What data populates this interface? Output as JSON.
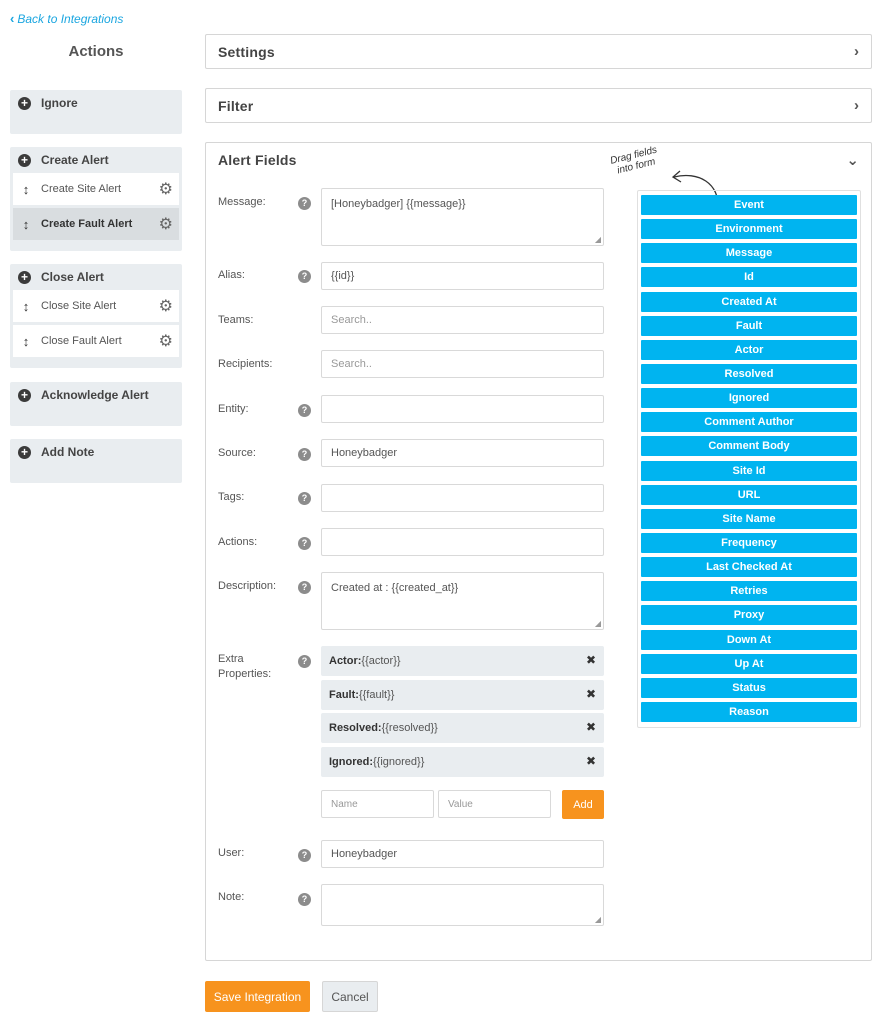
{
  "back_link": "Back to Integrations",
  "sidebar": {
    "title": "Actions",
    "groups": [
      {
        "label": "Ignore",
        "items": []
      },
      {
        "label": "Create Alert",
        "items": [
          {
            "label": "Create Site Alert"
          },
          {
            "label": "Create Fault Alert"
          }
        ]
      },
      {
        "label": "Close Alert",
        "items": [
          {
            "label": "Close Site Alert"
          },
          {
            "label": "Close Fault Alert"
          }
        ]
      },
      {
        "label": "Acknowledge Alert",
        "items": []
      },
      {
        "label": "Add Note",
        "items": []
      }
    ]
  },
  "panels": {
    "settings": "Settings",
    "filter": "Filter",
    "alert_fields": "Alert Fields"
  },
  "fields": {
    "message": {
      "label": "Message:",
      "value": "[Honeybadger] {{message}}"
    },
    "alias": {
      "label": "Alias:",
      "value": "{{id}}"
    },
    "teams": {
      "label": "Teams:",
      "placeholder": "Search.."
    },
    "recipients": {
      "label": "Recipients:",
      "placeholder": "Search.."
    },
    "entity": {
      "label": "Entity:",
      "value": ""
    },
    "source": {
      "label": "Source:",
      "value": "Honeybadger"
    },
    "tags": {
      "label": "Tags:",
      "value": ""
    },
    "actions": {
      "label": "Actions:",
      "value": ""
    },
    "description": {
      "label": "Description:",
      "value": "Created at : {{created_at}}"
    },
    "extra_properties": {
      "label_line1": "Extra",
      "label_line2": "Properties:",
      "items": [
        {
          "key": "Actor:",
          "value": "{{actor}}"
        },
        {
          "key": "Fault:",
          "value": "{{fault}}"
        },
        {
          "key": "Resolved:",
          "value": "{{resolved}}"
        },
        {
          "key": "Ignored:",
          "value": "{{ignored}}"
        }
      ],
      "name_placeholder": "Name",
      "value_placeholder": "Value",
      "add_label": "Add"
    },
    "user": {
      "label": "User:",
      "value": "Honeybadger"
    },
    "note": {
      "label": "Note:",
      "value": ""
    }
  },
  "drag_hint": {
    "line1": "Drag fields",
    "line2": "into form"
  },
  "dynamic_fields": [
    "Event",
    "Environment",
    "Message",
    "Id",
    "Created At",
    "Fault",
    "Actor",
    "Resolved",
    "Ignored",
    "Comment Author",
    "Comment Body",
    "Site Id",
    "URL",
    "Site Name",
    "Frequency",
    "Last Checked At",
    "Retries",
    "Proxy",
    "Down At",
    "Up At",
    "Status",
    "Reason"
  ],
  "footer": {
    "save_label": "Save Integration",
    "cancel_label": "Cancel"
  },
  "colors": {
    "accent_blue": "#00b4f0",
    "orange": "#f7931e",
    "link": "#1ba6e0"
  }
}
